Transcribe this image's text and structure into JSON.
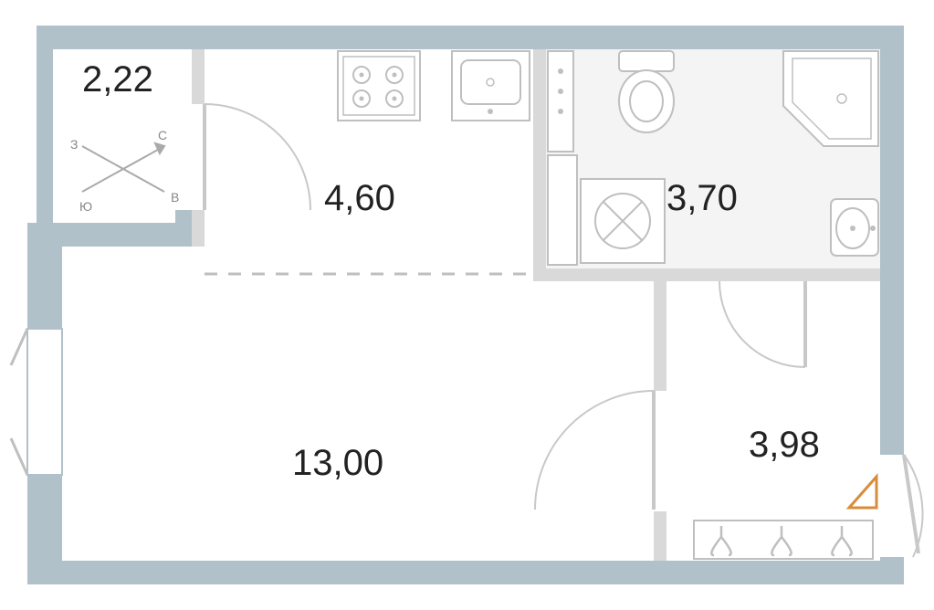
{
  "rooms": {
    "balcony": {
      "area": "2,22"
    },
    "kitchen": {
      "area": "4,60"
    },
    "bathroom": {
      "area": "3,70"
    },
    "living": {
      "area": "13,00"
    },
    "hall": {
      "area": "3,98"
    }
  },
  "compass": {
    "n": "С",
    "s": "Ю",
    "e": "В",
    "w": "З"
  },
  "colors": {
    "wall": "#b0c1ca",
    "inner_wall": "#d9d9d9",
    "fixture": "#bfbfbf",
    "fixture_light": "#ededed",
    "door_arc": "#c8c8c8",
    "entry_marker": "#d88c3a",
    "dash": "#bfbfbf"
  }
}
